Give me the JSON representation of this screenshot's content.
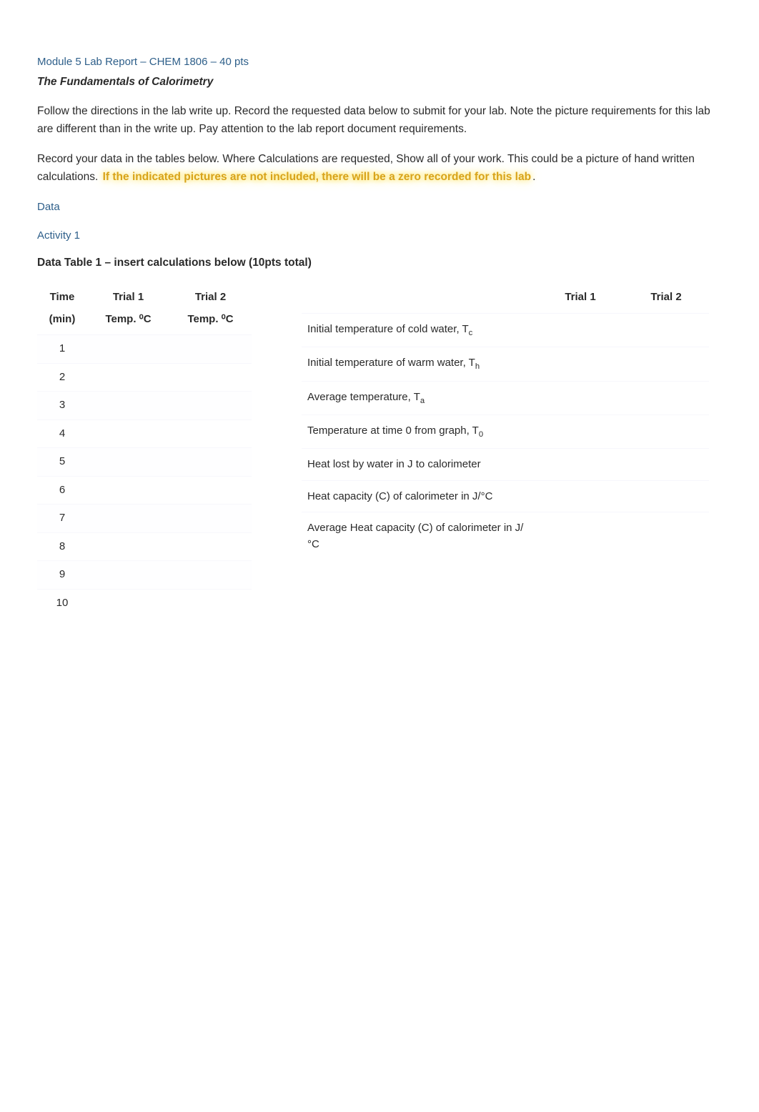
{
  "header": {
    "module_title": "Module 5 Lab Report – CHEM 1806 – 40 pts",
    "subtitle": "The Fundamentals of Calorimetry"
  },
  "intro": {
    "p1": "Follow the directions in the lab write up. Record the requested data below to submit for your lab. Note the picture requirements for this lab are different than in the write up. Pay attention to the lab report document requirements.",
    "p2_a": "Record your data in the tables below. Where Calculations are requested, Show all of your work. This could be a picture of hand written calculations",
    "p2_period1": ". ",
    "warning": "If the indicated pictures are not included, there will be a zero recorded for this lab",
    "p2_period2": "."
  },
  "sections": {
    "data": "Data",
    "activity1": "Activity 1",
    "table_caption": "Data Table 1 – insert calculations below (10pts total)"
  },
  "time_table": {
    "headers": {
      "time": "Time",
      "trial1": "Trial 1",
      "trial2": "Trial 2",
      "min": "(min)",
      "t1unit": "Temp. ⁰C",
      "t2unit": "Temp. ⁰C"
    },
    "rows": [
      {
        "time": "1",
        "t1": "",
        "t2": ""
      },
      {
        "time": "2",
        "t1": "",
        "t2": ""
      },
      {
        "time": "3",
        "t1": "",
        "t2": ""
      },
      {
        "time": "4",
        "t1": "",
        "t2": ""
      },
      {
        "time": "5",
        "t1": "",
        "t2": ""
      },
      {
        "time": "6",
        "t1": "",
        "t2": ""
      },
      {
        "time": "7",
        "t1": "",
        "t2": ""
      },
      {
        "time": "8",
        "t1": "",
        "t2": ""
      },
      {
        "time": "9",
        "t1": "",
        "t2": ""
      },
      {
        "time": "10",
        "t1": "",
        "t2": ""
      }
    ]
  },
  "calc_table": {
    "headers": {
      "blank": "",
      "trial1": "Trial 1",
      "trial2": "Trial 2"
    },
    "rows": [
      {
        "label_pre": "Initial temperature of cold water, T",
        "sub": "c",
        "label_post": "",
        "t1": "",
        "t2": ""
      },
      {
        "label_pre": "Initial temperature of warm water, T",
        "sub": "h",
        "label_post": "",
        "t1": "",
        "t2": ""
      },
      {
        "label_pre": "Average temperature, T",
        "sub": "a",
        "label_post": "",
        "t1": "",
        "t2": ""
      },
      {
        "label_pre": "Temperature at time 0 from graph, T",
        "sub": "0",
        "label_post": "",
        "t1": "",
        "t2": ""
      },
      {
        "label_pre": "Heat lost by water in J to calorimeter",
        "sub": "",
        "label_post": "",
        "t1": "",
        "t2": ""
      },
      {
        "label_pre": "Heat capacity (C) of calorimeter in J/°C",
        "sub": "",
        "label_post": "",
        "t1": "",
        "t2": ""
      },
      {
        "label_pre": "Average Heat capacity (C) of calorimeter in J/°C",
        "sub": "",
        "label_post": "",
        "t1": "",
        "t2": ""
      }
    ]
  }
}
